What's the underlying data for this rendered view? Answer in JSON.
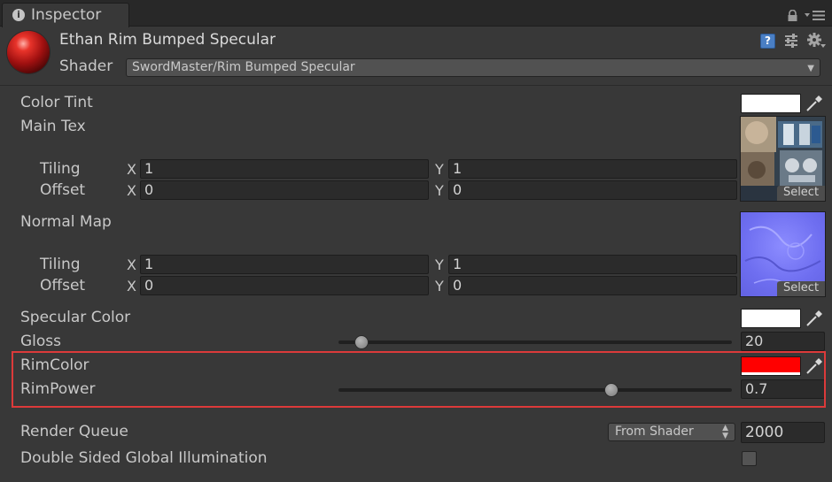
{
  "tab": {
    "title": "Inspector"
  },
  "material": {
    "name": "Ethan Rim Bumped Specular",
    "shader_label": "Shader",
    "shader_value": "SwordMaster/Rim Bumped Specular"
  },
  "properties": {
    "color_tint": {
      "label": "Color Tint",
      "color": "#ffffff"
    },
    "main_tex": {
      "label": "Main Tex",
      "tiling_label": "Tiling",
      "offset_label": "Offset",
      "x_label": "X",
      "y_label": "Y",
      "tiling_x": "1",
      "tiling_y": "1",
      "offset_x": "0",
      "offset_y": "0",
      "select_label": "Select"
    },
    "normal_map": {
      "label": "Normal Map",
      "tiling_label": "Tiling",
      "offset_label": "Offset",
      "x_label": "X",
      "y_label": "Y",
      "tiling_x": "1",
      "tiling_y": "1",
      "offset_x": "0",
      "offset_y": "0",
      "select_label": "Select"
    },
    "specular_color": {
      "label": "Specular Color",
      "color": "#ffffff"
    },
    "gloss": {
      "label": "Gloss",
      "value": "20",
      "slider_fraction": 0.078
    },
    "rim_color": {
      "label": "RimColor",
      "color": "#ff0000"
    },
    "rim_power": {
      "label": "RimPower",
      "value": "0.7",
      "slider_fraction": 0.69
    }
  },
  "render_queue": {
    "label": "Render Queue",
    "mode": "From Shader",
    "value": "2000"
  },
  "dsgi": {
    "label": "Double Sided Global Illumination",
    "checked": false
  },
  "colors": {
    "highlight": "#dc3a3a",
    "background": "#383838",
    "field": "#2b2b2b"
  }
}
